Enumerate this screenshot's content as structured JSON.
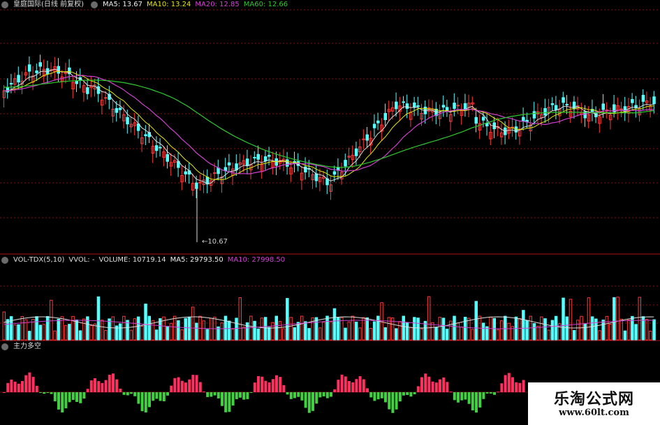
{
  "main_header": {
    "stock": "皇庭国际(日线 前复权)",
    "ma5": "MA5: 13.67",
    "ma10": "MA10: 13.24",
    "ma20": "MA20: 12.85",
    "ma60": "MA60: 12.66"
  },
  "low_price_label": "10.67",
  "volume_header": {
    "indicator": "VOL-TDX(5,10)",
    "vvol": "VVOL: -",
    "volume": "VOLUME: 10719.14",
    "ma5": "MA5: 29793.50",
    "ma10": "MA10: 27998.50"
  },
  "indicator_header": {
    "name": "主力多空"
  },
  "watermark": {
    "title": "乐淘公式网",
    "url": "www.60lt.com"
  },
  "colors": {
    "up": "#ff3838",
    "down": "#54ffff",
    "ma5": "#dddddd",
    "ma10": "#e8e800",
    "ma20": "#d040d0",
    "ma60": "#2ec82e",
    "pos_bar": "#ff3060",
    "neg_bar": "#40d040",
    "grid": "#8a1010"
  }
}
